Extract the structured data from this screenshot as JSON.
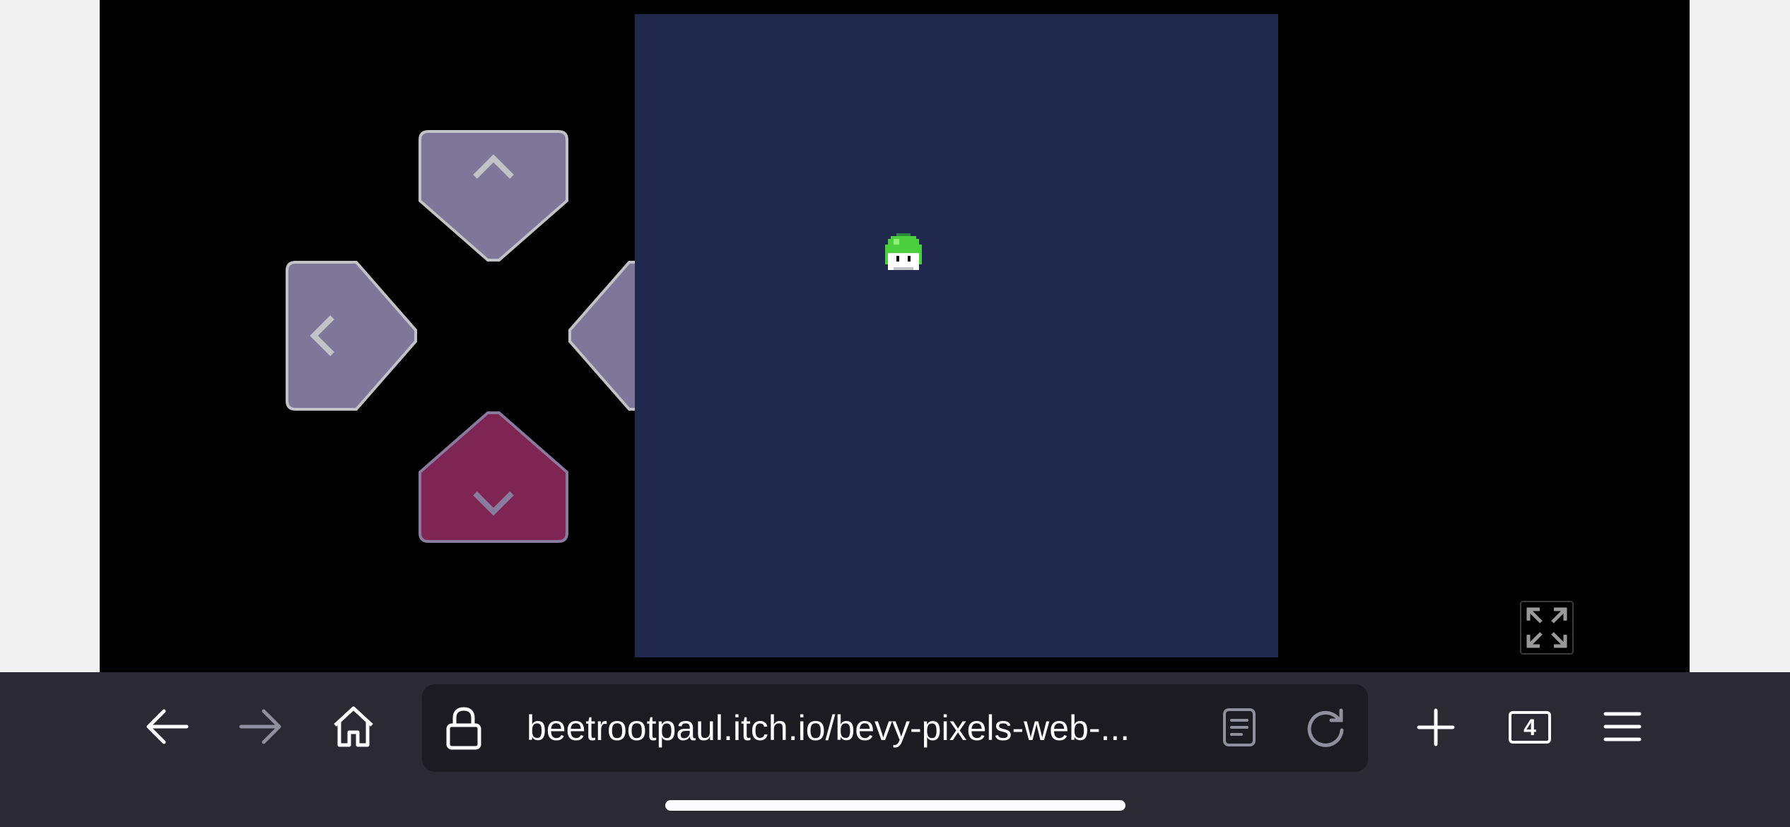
{
  "game": {
    "colors": {
      "frame_background": "#000000",
      "canvas_background": "#20284e",
      "dpad_inactive_fill": "#7e7799",
      "dpad_inactive_border": "#c2c3c7",
      "dpad_active_fill": "#7e2553",
      "dpad_active_border": "#8a7a9e",
      "player_sprite": "#4ccf3f"
    },
    "dpad": {
      "up": {
        "icon": "chevron-up-icon",
        "pressed": false
      },
      "left": {
        "icon": "chevron-left-icon",
        "pressed": false
      },
      "right": {
        "icon": "chevron-right-icon",
        "pressed": false
      },
      "down": {
        "icon": "chevron-down-icon",
        "pressed": true
      }
    },
    "fullscreen_icon": "expand-icon"
  },
  "browser": {
    "url": "beetrootpaul.itch.io/bevy-pixels-web-...",
    "tab_count": "4",
    "icons": {
      "back": "arrow-left-icon",
      "forward": "arrow-right-icon",
      "home": "home-icon",
      "lock": "lock-icon",
      "reader": "reader-view-icon",
      "reload": "reload-icon",
      "new_tab": "plus-icon",
      "menu": "hamburger-menu-icon"
    },
    "colors": {
      "toolbar": "#2b2a33",
      "url_field": "#1c1b22",
      "text": "#fbfbfe",
      "disabled": "#8f8f9d"
    }
  }
}
